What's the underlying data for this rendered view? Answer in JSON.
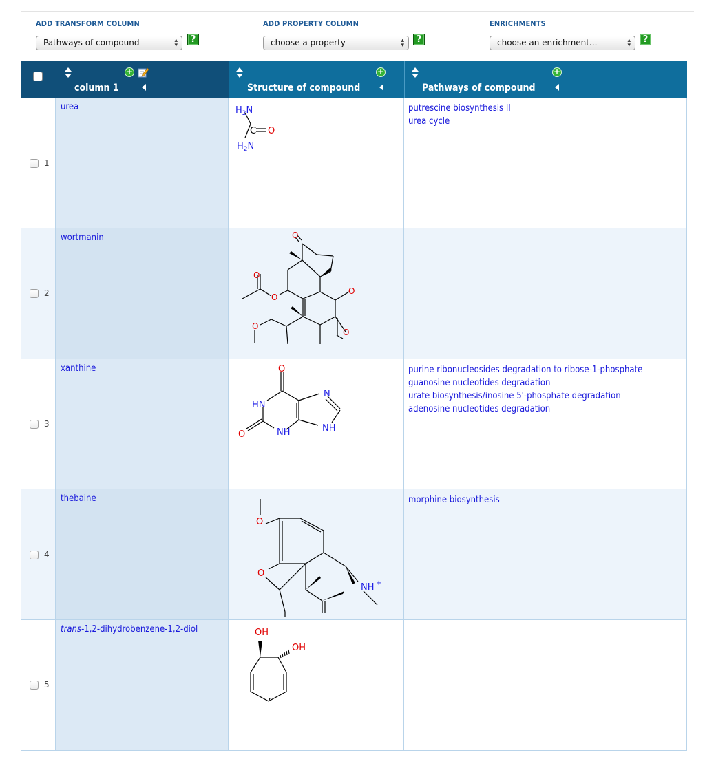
{
  "controls": {
    "transform": {
      "label": "ADD TRANSFORM COLUMN",
      "value": "Pathways of compound"
    },
    "property": {
      "label": "ADD PROPERTY COLUMN",
      "value": "choose a property"
    },
    "enrichment": {
      "label": "ENRICHMENTS",
      "value": "choose an enrichment..."
    },
    "help_glyph": "?"
  },
  "table": {
    "columns": [
      {
        "title": "column 1"
      },
      {
        "title": "Structure of compound"
      },
      {
        "title": "Pathways of compound"
      }
    ],
    "rows": [
      {
        "num": "1",
        "name": "urea",
        "pathways": [
          "putrescine biosynthesis II",
          "urea cycle"
        ]
      },
      {
        "num": "2",
        "name": "wortmanin",
        "pathways": []
      },
      {
        "num": "3",
        "name": "xanthine",
        "pathways": [
          "purine ribonucleosides degradation to ribose-1-phosphate",
          "guanosine nucleotides degradation",
          "urate biosynthesis/inosine 5'-phosphate degradation",
          "adenosine nucleotides degradation"
        ]
      },
      {
        "num": "4",
        "name": "thebaine",
        "pathways": [
          "morphine biosynthesis"
        ]
      },
      {
        "num": "5",
        "name_prefix": "trans",
        "name": "-1,2-dihydrobenzene-1,2-diol",
        "pathways": []
      }
    ]
  },
  "structures": {
    "urea": {
      "nh2_top": "H2N",
      "c": "C",
      "o": "O",
      "nh2_bot": "H2N"
    },
    "wortmanin": {
      "o": "O"
    },
    "xanthine": {
      "o": "O",
      "n": "N",
      "hn": "HN",
      "nh": "NH"
    },
    "thebaine": {
      "o": "O",
      "nh": "NH",
      "plus": "+"
    },
    "diol": {
      "oh": "OH"
    }
  },
  "colors": {
    "header_blue": "#0f6e9d",
    "header_dark": "#104f79",
    "link_blue": "#1a1adb",
    "heteroatom_red": "#e00000",
    "nitrogen_blue": "#1e1ee6"
  },
  "icons": [
    "sort-arrows-icon",
    "add-column-icon",
    "edit-icon",
    "collapse-left-icon",
    "help-icon",
    "select-arrows-icon"
  ]
}
